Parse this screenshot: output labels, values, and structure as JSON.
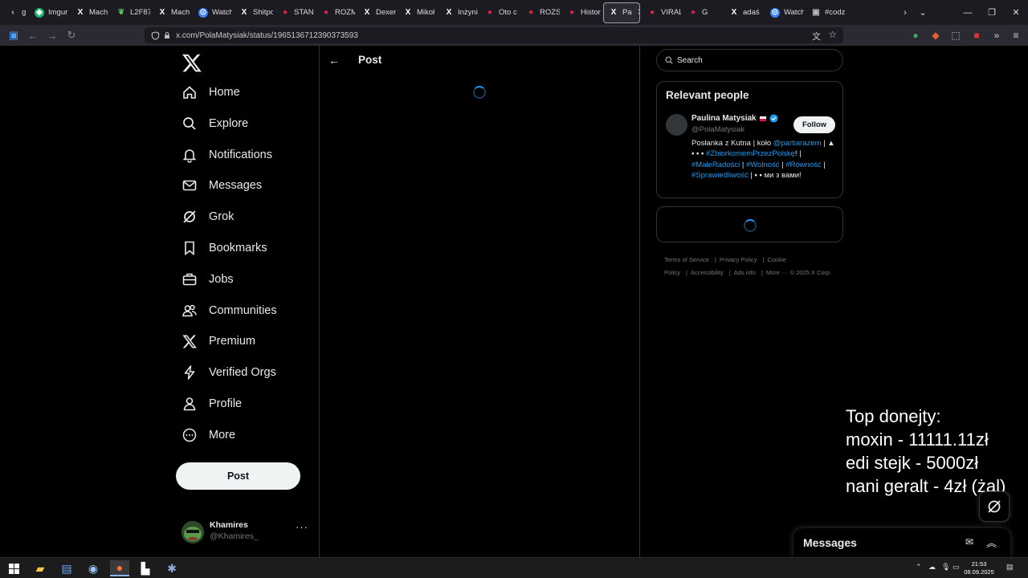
{
  "browser": {
    "tabs": [
      {
        "label": "g",
        "icon": "chevron-left-icon"
      },
      {
        "label": "Imgur",
        "icon": "imgur-icon"
      },
      {
        "label": "Mach",
        "icon": "x-icon"
      },
      {
        "label": "L2F87",
        "icon": "leaf-icon"
      },
      {
        "label": "Mach",
        "icon": "x-icon"
      },
      {
        "label": "Watch",
        "icon": "watch-icon"
      },
      {
        "label": "Shitpo",
        "icon": "x-icon"
      },
      {
        "label": "STAN",
        "icon": "red-icon"
      },
      {
        "label": "ROZM",
        "icon": "red-icon"
      },
      {
        "label": "Dexer",
        "icon": "x-icon"
      },
      {
        "label": "Mikoł",
        "icon": "x-icon"
      },
      {
        "label": "Inżyni",
        "icon": "x-icon"
      },
      {
        "label": "Oto c",
        "icon": "red-icon"
      },
      {
        "label": "ROZST",
        "icon": "red-icon"
      },
      {
        "label": "Histor",
        "icon": "red-icon"
      },
      {
        "label": "Pa",
        "icon": "x-icon",
        "active": true
      },
      {
        "label": "VIRAL",
        "icon": "red-icon"
      },
      {
        "label": "G",
        "icon": "red-icon"
      },
      {
        "label": "adaś",
        "icon": "x-icon"
      },
      {
        "label": "Watch",
        "icon": "watch-icon"
      },
      {
        "label": "#codz",
        "icon": "dot-icon"
      }
    ],
    "url": "x.com/PolaMatysiak/status/1965136712390373593"
  },
  "sidebar": {
    "items": [
      {
        "label": "Home",
        "icon": "home-icon"
      },
      {
        "label": "Explore",
        "icon": "search-icon"
      },
      {
        "label": "Notifications",
        "icon": "bell-icon"
      },
      {
        "label": "Messages",
        "icon": "envelope-icon"
      },
      {
        "label": "Grok",
        "icon": "grok-icon"
      },
      {
        "label": "Bookmarks",
        "icon": "bookmark-icon"
      },
      {
        "label": "Jobs",
        "icon": "briefcase-icon"
      },
      {
        "label": "Communities",
        "icon": "people-icon"
      },
      {
        "label": "Premium",
        "icon": "x-icon"
      },
      {
        "label": "Verified Orgs",
        "icon": "lightning-icon"
      },
      {
        "label": "Profile",
        "icon": "person-icon"
      },
      {
        "label": "More",
        "icon": "more-circle-icon"
      }
    ],
    "post_label": "Post",
    "account": {
      "name": "Khamires",
      "handle": "@Khamires_"
    }
  },
  "main": {
    "header_title": "Post"
  },
  "right": {
    "search_placeholder": "Search",
    "relevant_title": "Relevant people",
    "person": {
      "name": "Paulina Matysiak",
      "handle": "@PolaMatysiak",
      "follow_label": "Follow",
      "bio_parts": [
        {
          "text": "Posłanka z Kutna | koło ",
          "link": false
        },
        {
          "text": "@partiarazem",
          "link": true
        },
        {
          "text": " | ▲ ▪ ▪ ▪ ",
          "link": false
        },
        {
          "text": "#ZbiorkomemPrzezPolskę",
          "link": true
        },
        {
          "text": "! | ",
          "link": false
        },
        {
          "text": "#MałeRadości",
          "link": true
        },
        {
          "text": " | ",
          "link": false
        },
        {
          "text": "#Wolność",
          "link": true
        },
        {
          "text": " | ",
          "link": false
        },
        {
          "text": "#Równość",
          "link": true
        },
        {
          "text": " | ",
          "link": false
        },
        {
          "text": "#Sprawiedliwość",
          "link": true
        },
        {
          "text": " | ▪ ▪ ми з вами!",
          "link": false
        }
      ]
    },
    "footer": [
      "Terms of Service",
      "|",
      "Privacy Policy",
      "|",
      "Cookie Policy",
      "|",
      "Accessibility",
      "|",
      "Ads info",
      "|",
      "More ···",
      "© 2025 X Corp."
    ]
  },
  "overlay": {
    "lines": [
      "Top donejty:",
      "moxin - 11111.11zł",
      "edi stejk - 5000zł",
      "nani geralt - 4zł (żal)"
    ]
  },
  "messages_drawer": {
    "title": "Messages"
  },
  "taskbar": {
    "time": "21:53",
    "date": "08.09.2025"
  },
  "colors": {
    "accent": "#1d9bf0",
    "background": "#000000",
    "border": "#2f3336"
  }
}
